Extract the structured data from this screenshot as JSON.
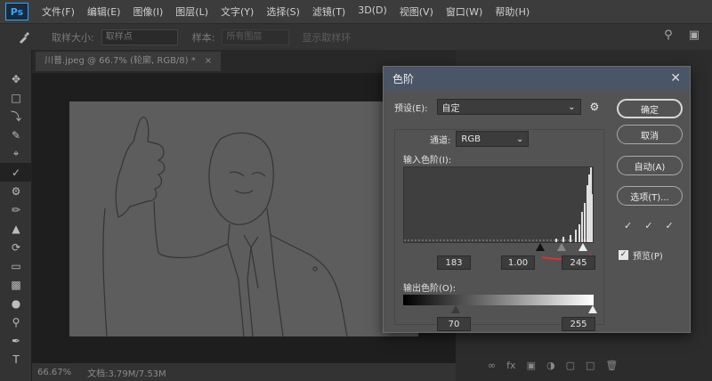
{
  "app": {
    "logo": "Ps"
  },
  "menu": [
    "文件(F)",
    "编辑(E)",
    "图像(I)",
    "图层(L)",
    "文字(Y)",
    "选择(S)",
    "滤镜(T)",
    "3D(D)",
    "视图(V)",
    "窗口(W)",
    "帮助(H)"
  ],
  "options": {
    "tool_icon": "eyedropper-icon",
    "sample_size_label": "取样大小:",
    "sample_size_value": "取样点",
    "sample_label": "样本:",
    "sample_value": "所有图层",
    "show_ring_label": "显示取样环"
  },
  "document": {
    "tab_title": "川普.jpeg @ 66.7% (轮廓, RGB/8) *",
    "zoom": "66.67%",
    "doc_size": "文档:3.79M/7.53M"
  },
  "dialog": {
    "title": "色阶",
    "preset_label": "预设(E):",
    "preset_value": "自定",
    "channel_label": "通道:",
    "channel_value": "RGB",
    "input_levels_label": "输入色阶(I):",
    "input_black": "183",
    "input_gamma": "1.00",
    "input_white": "245",
    "output_levels_label": "输出色阶(O):",
    "output_black": "70",
    "output_white": "255",
    "buttons": {
      "ok": "确定",
      "cancel": "取消",
      "auto": "自动(A)",
      "options": "选项(T)..."
    },
    "preview_label": "预览(P)",
    "preview_checked": true
  },
  "colors": {
    "accent": "#31a8ff",
    "dialog_title_bar": "#4a5566",
    "annotation": "#e03030"
  }
}
